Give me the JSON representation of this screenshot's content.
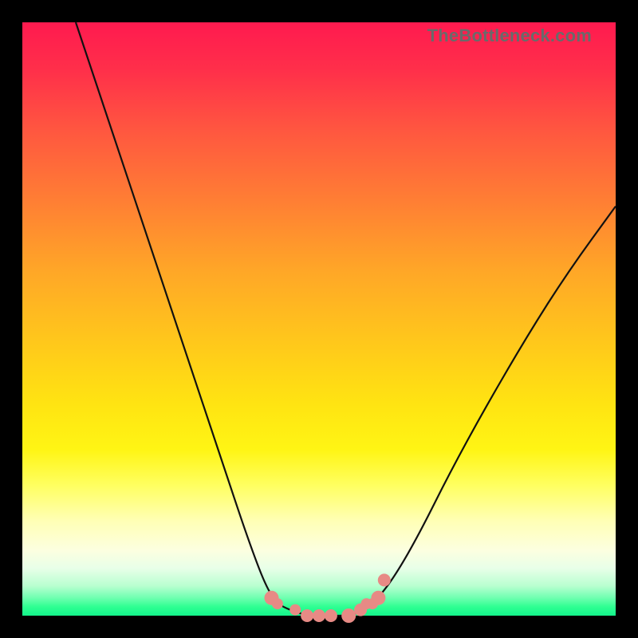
{
  "attribution": "TheBottleneck.com",
  "colors": {
    "background_frame": "#000000",
    "gradient_top": "#ff1a4f",
    "gradient_bottom": "#13f58b",
    "curve": "#111111",
    "dots": "#e78a85"
  },
  "chart_data": {
    "type": "line",
    "title": "",
    "xlabel": "",
    "ylabel": "",
    "xlim": [
      0,
      100
    ],
    "ylim": [
      0,
      100
    ],
    "grid": false,
    "legend": false,
    "note": "Axes are unlabeled in source image; x and y values are estimated on a 0–100 scale reading off the curve geometry relative to the plot area.",
    "series": [
      {
        "name": "curve",
        "x": [
          9,
          12,
          16,
          22,
          28,
          34,
          38,
          41,
          43,
          45,
          48,
          52,
          55,
          58,
          60,
          63,
          67,
          72,
          78,
          85,
          92,
          100
        ],
        "y": [
          100,
          91,
          79,
          61,
          43,
          25,
          13,
          5,
          2,
          1,
          0,
          0,
          0,
          1,
          3,
          7,
          14,
          24,
          35,
          47,
          58,
          69
        ]
      }
    ],
    "markers": {
      "name": "dots-near-minimum",
      "x": [
        42,
        43,
        46,
        48,
        50,
        52,
        55,
        57,
        58,
        59,
        60,
        61
      ],
      "y": [
        3,
        2,
        1,
        0,
        0,
        0,
        0,
        1,
        2,
        2,
        3,
        6
      ],
      "radius_px_approx": [
        9,
        7,
        7,
        8,
        8,
        8,
        9,
        8,
        7,
        7,
        9,
        8
      ]
    },
    "shape_summary": "V-shaped curve: steep descending left branch starting near top-left, flat bottom around x≈45–57 (touching y≈0), gentler ascending right branch exiting near upper-right at roughly 69% height."
  }
}
